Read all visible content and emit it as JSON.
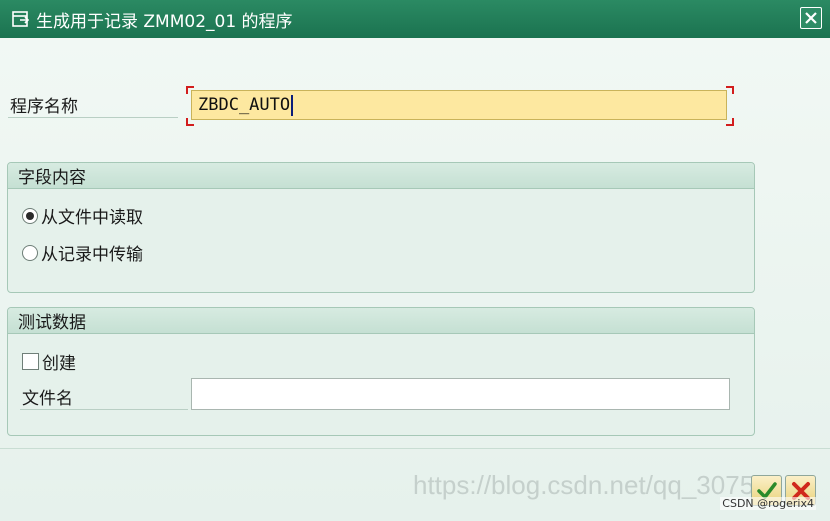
{
  "window": {
    "title": "生成用于记录 ZMM02_01 的程序"
  },
  "program_name": {
    "label": "程序名称",
    "value": "ZBDC_AUTO"
  },
  "field_contents": {
    "header": "字段内容",
    "options": [
      {
        "label": "从文件中读取",
        "selected": true
      },
      {
        "label": "从记录中传输",
        "selected": false
      }
    ]
  },
  "test_data": {
    "header": "测试数据",
    "create_label": "创建",
    "create_checked": false,
    "file_label": "文件名",
    "file_value": ""
  },
  "footer": {
    "watermark": "https://blog.csdn.net/qq_3075",
    "credit": "CSDN @rogerix4"
  },
  "colors": {
    "titlebar": "#1b7350",
    "accent_input": "#fde8a0",
    "required_marker": "#d21d1d"
  },
  "icons": {
    "title": "dialog-icon",
    "close": "close-icon",
    "ok": "check-icon",
    "cancel": "cancel-icon"
  }
}
